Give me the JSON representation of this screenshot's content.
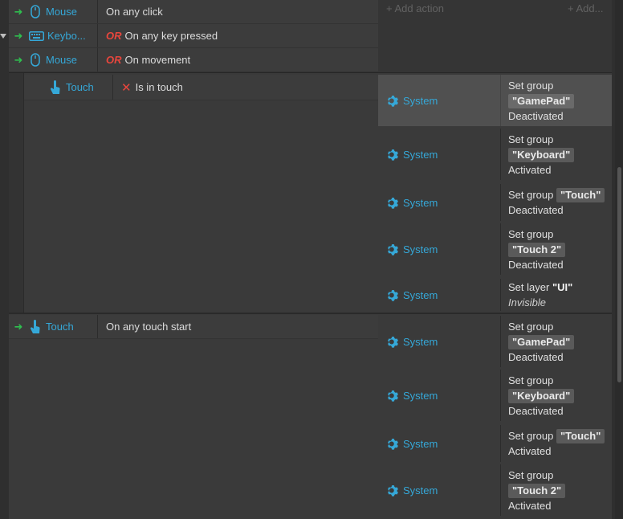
{
  "toolbar": {
    "add_action": "+ Add action",
    "add_more": "+ Add..."
  },
  "colors": {
    "accent": "#35a8d8",
    "or": "#e8463d",
    "arrow": "#2fbf4f",
    "invert": "#e8463d"
  },
  "event1": {
    "conditions": [
      {
        "object": "Mouse",
        "icon": "mouse-icon",
        "text": "On any click",
        "or": ""
      },
      {
        "object": "Keybo...",
        "icon": "keyboard-icon",
        "text": "On any key pressed",
        "or": "OR"
      },
      {
        "object": "Mouse",
        "icon": "mouse-icon",
        "text": "On movement",
        "or": "OR"
      }
    ]
  },
  "sub_event": {
    "condition": {
      "object": "Touch",
      "icon": "touch-icon",
      "invert": "✕",
      "text": "Is in touch"
    },
    "actions": [
      {
        "object": "System",
        "line1": "Set group",
        "value": "\"GamePad\"",
        "state": "Deactivated"
      },
      {
        "object": "System",
        "line1": "Set group",
        "value": "\"Keyboard\"",
        "state": "Activated"
      },
      {
        "object": "System",
        "line1": "Set group",
        "value": "\"Touch\"",
        "state": "Deactivated"
      },
      {
        "object": "System",
        "line1": "Set group",
        "value": "\"Touch 2\"",
        "state": "Deactivated"
      },
      {
        "object": "System",
        "line1": "Set layer",
        "value": "\"UI\"",
        "state": "Invisible"
      }
    ]
  },
  "event2": {
    "condition": {
      "object": "Touch",
      "icon": "touch-icon",
      "text": "On any touch start"
    },
    "actions": [
      {
        "object": "System",
        "line1": "Set group",
        "value": "\"GamePad\"",
        "state": "Deactivated"
      },
      {
        "object": "System",
        "line1": "Set group",
        "value": "\"Keyboard\"",
        "state": "Deactivated"
      },
      {
        "object": "System",
        "line1": "Set group",
        "value": "\"Touch\"",
        "state": "Activated"
      },
      {
        "object": "System",
        "line1": "Set group",
        "value": "\"Touch 2\"",
        "state": "Activated"
      }
    ]
  }
}
